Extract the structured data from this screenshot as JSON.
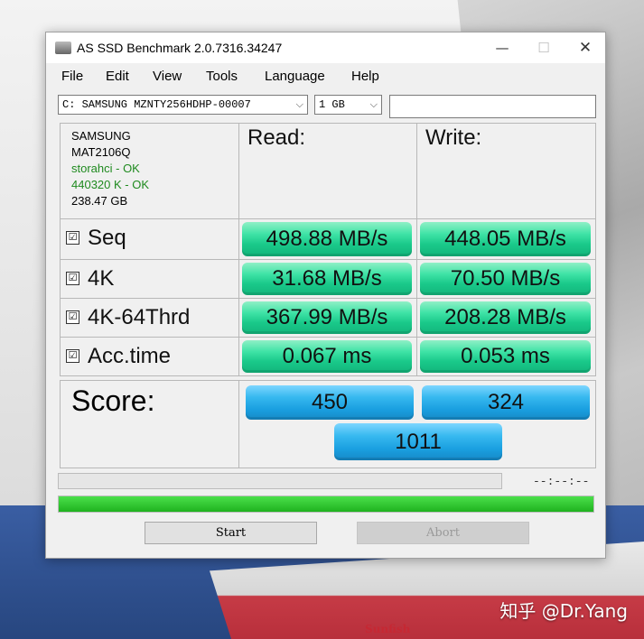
{
  "window": {
    "title": "AS SSD Benchmark 2.0.7316.34247"
  },
  "window_controls": {
    "minimize": "—",
    "maximize": "☐",
    "close": "✕"
  },
  "menu": [
    "File",
    "Edit",
    "View",
    "Tools",
    "Language",
    "Help"
  ],
  "selectors": {
    "drive": "C: SAMSUNG MZNTY256HDHP-00007",
    "size": "1 GB",
    "extra_value": ""
  },
  "drive_info": {
    "vendor": "SAMSUNG",
    "firmware": "MAT2106Q",
    "driver_status": "storahci - OK",
    "alignment_status": "440320 K - OK",
    "capacity": "238.47 GB"
  },
  "headers": {
    "read": "Read:",
    "write": "Write:"
  },
  "tests": [
    {
      "label": "Seq",
      "checked": true,
      "read": "498.88 MB/s",
      "write": "448.05 MB/s"
    },
    {
      "label": "4K",
      "checked": true,
      "read": "31.68 MB/s",
      "write": "70.50 MB/s"
    },
    {
      "label": "4K-64Thrd",
      "checked": true,
      "read": "367.99 MB/s",
      "write": "208.28 MB/s"
    },
    {
      "label": "Acc.time",
      "checked": true,
      "read": "0.067 ms",
      "write": "0.053 ms"
    }
  ],
  "checkbox_mark": "☑",
  "score": {
    "label": "Score:",
    "read": "450",
    "write": "324",
    "total": "1011"
  },
  "status": {
    "time": "--:--:--",
    "overall_progress": 1.0
  },
  "buttons": {
    "start": "Start",
    "abort": "Abort"
  },
  "overlay": {
    "watermark": "知乎 @Dr.Yang",
    "boat_brand": "Sunfish"
  },
  "colors": {
    "result_green": "#1ac98a",
    "score_blue": "#1a9fe0",
    "progress_green": "#1fb21f"
  }
}
